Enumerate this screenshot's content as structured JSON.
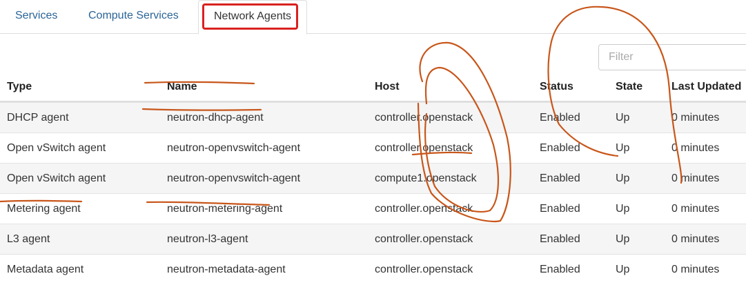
{
  "tabs": [
    {
      "label": "Services"
    },
    {
      "label": "Compute Services"
    },
    {
      "label": "Network Agents"
    }
  ],
  "filter": {
    "placeholder": "Filter",
    "value": ""
  },
  "table": {
    "columns": [
      "Type",
      "Name",
      "Host",
      "Status",
      "State",
      "Last Updated"
    ],
    "rows": [
      {
        "type": "DHCP agent",
        "name": "neutron-dhcp-agent",
        "host": "controller.openstack",
        "status": "Enabled",
        "state": "Up",
        "updated": "0 minutes"
      },
      {
        "type": "Open vSwitch agent",
        "name": "neutron-openvswitch-agent",
        "host": "controller.openstack",
        "status": "Enabled",
        "state": "Up",
        "updated": "0 minutes"
      },
      {
        "type": "Open vSwitch agent",
        "name": "neutron-openvswitch-agent",
        "host": "compute1.openstack",
        "status": "Enabled",
        "state": "Up",
        "updated": "0 minutes"
      },
      {
        "type": "Metering agent",
        "name": "neutron-metering-agent",
        "host": "controller.openstack",
        "status": "Enabled",
        "state": "Up",
        "updated": "0 minutes"
      },
      {
        "type": "L3 agent",
        "name": "neutron-l3-agent",
        "host": "controller.openstack",
        "status": "Enabled",
        "state": "Up",
        "updated": "0 minutes"
      },
      {
        "type": "Metadata agent",
        "name": "neutron-metadata-agent",
        "host": "controller.openstack",
        "status": "Enabled",
        "state": "Up",
        "updated": "0 minutes"
      }
    ]
  },
  "colors": {
    "tab_link": "#2a6496",
    "highlight_box": "#d9211f",
    "annotation_ink": "#c8561a",
    "striped_row": "#f5f5f5"
  }
}
